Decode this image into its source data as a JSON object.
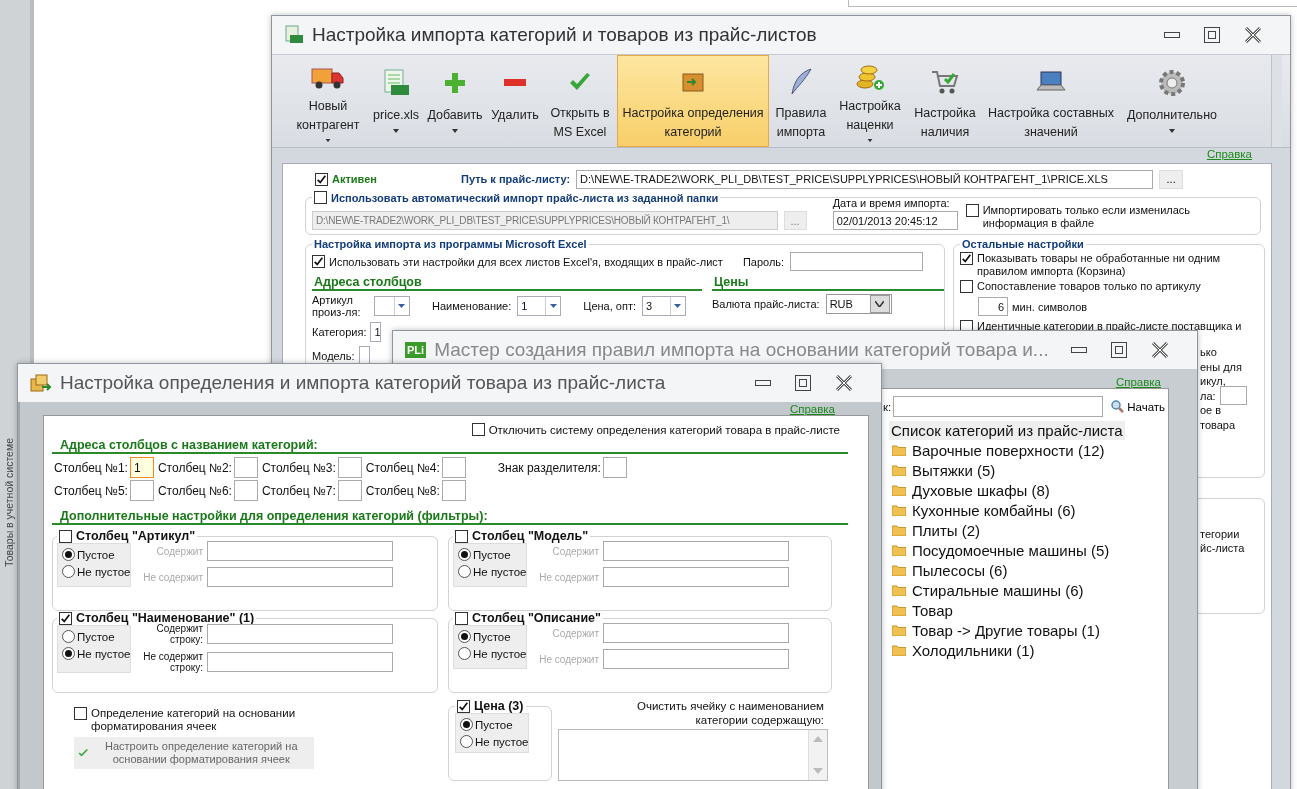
{
  "desktop": {
    "side_tab": "Товары в учетной системе"
  },
  "main_window": {
    "title": "Настройка импорта категорий и товаров из прайс-листов",
    "toolbar": [
      {
        "label": "Новый контрагент",
        "dropdown": true,
        "selected": false
      },
      {
        "label": "price.xls",
        "dropdown": true,
        "selected": false
      },
      {
        "label": "Добавить",
        "dropdown": true,
        "selected": false
      },
      {
        "label": "Удалить",
        "dropdown": false,
        "selected": false
      },
      {
        "label": "Открыть в MS Excel",
        "dropdown": false,
        "selected": false
      },
      {
        "label": "Настройка определения категорий",
        "dropdown": false,
        "selected": true
      },
      {
        "label": "Правила импорта",
        "dropdown": false,
        "selected": false
      },
      {
        "label": "Настройка наценки",
        "dropdown": true,
        "selected": false
      },
      {
        "label": "Настройка наличия",
        "dropdown": false,
        "selected": false
      },
      {
        "label": "Настройка составных значений",
        "dropdown": false,
        "selected": false
      },
      {
        "label": "Дополнительно",
        "dropdown": true,
        "selected": false
      }
    ],
    "help": "Справка",
    "active": {
      "label": "Активен",
      "checked": true
    },
    "path": {
      "label": "Путь к прайс-листу:",
      "value": "D:\\NEW\\E-TRADE2\\WORK_PLI_DB\\TEST_PRICE\\SUPPLYPRICES\\НОВЫЙ КОНТРАГЕНТ_1\\PRICE.XLS",
      "browse": "..."
    },
    "auto_import": {
      "label": "Использовать автоматический импорт прайс-листа из заданной папки",
      "checked": false,
      "folder": "D:\\NEW\\E-TRADE2\\WORK_PLI_DB\\TEST_PRICE\\SUPPLYPRICES\\НОВЫЙ КОНТРАГЕНТ_1\\",
      "browse": "...",
      "date_label": "Дата и время импорта:",
      "date": "02/01/2013 20:45:12",
      "only_changed": {
        "label": "Импортировать только если изменилась информация в файле",
        "checked": false
      }
    },
    "excel": {
      "title": "Настройка импорта из программы Microsoft Excel",
      "all_sheets": {
        "label": "Использовать эти настройки для всех листов Excel'я, входящих в прайс-лист",
        "checked": true
      },
      "password_label": "Пароль:",
      "columns_title": "Адреса столбцов",
      "prices_title": "Цены",
      "columns": [
        {
          "label": "Артикул произ-ля:"
        },
        {
          "label": "Наименование:",
          "value": "1"
        },
        {
          "label": "Цена, опт:",
          "value": "3"
        }
      ],
      "currency": {
        "label": "Валюта прайс-листа:",
        "value": "RUB"
      },
      "more_columns": [
        {
          "label": "Категория:",
          "value": "1"
        },
        {
          "label": "Модель:"
        }
      ]
    },
    "other": {
      "title": "Остальные настройки",
      "options": [
        {
          "label": "Показывать товары не обработанные ни одним правилом импорта (Корзина)",
          "checked": true
        },
        {
          "label": "Сопоставление товаров только по артикулу",
          "checked": false,
          "min_value": "6",
          "min_label": "мин. символов"
        },
        {
          "label": "Идентичные категории в прайс-листе поставщика и",
          "checked": false
        }
      ],
      "fragments": [
        {
          "text": "ько",
          "field": false
        },
        {
          "text": "ены для",
          "field": false
        },
        {
          "text": "икул,",
          "field": false
        },
        {
          "text": "ла:",
          "field": true
        },
        {
          "text": "ое в",
          "field": false
        },
        {
          "text": "товара",
          "field": false
        }
      ],
      "lower_fragments": [
        "тегории",
        "йс-листа"
      ]
    }
  },
  "wizard_window": {
    "title": "Мастер создания правил импорта на основании категорий товара и...",
    "logo": "PLi",
    "help": "Справка",
    "search_label": "к:",
    "search_button": "Начать",
    "list_header": "Список категорий из прайс-листа",
    "categories": [
      "Варочные поверхности (12)",
      "Вытяжки (5)",
      "Духовые шкафы (8)",
      "Кухонные комбайны (6)",
      "Плиты (2)",
      "Посудомоечные машины (5)",
      "Пылесосы (6)",
      "Стиральные машины (6)",
      "Товар",
      "Товар -> Другие товары (1)",
      "Холодильники (1)"
    ]
  },
  "left_window": {
    "title": "Настройка определения и импорта категорий товара из прайс-листа",
    "help": "Справка",
    "disable": {
      "label": "Отключить систему определения категорий товара в прайс-листе",
      "checked": false
    },
    "columns_title": "Адреса столбцов с названием категорий:",
    "columns": [
      {
        "label": "Столбец №1:",
        "value": "1",
        "focused": true
      },
      {
        "label": "Столбец №2:",
        "focused": false
      },
      {
        "label": "Столбец №3:",
        "focused": false
      },
      {
        "label": "Столбец №4:",
        "focused": false
      },
      {
        "label": "Столбец №5:",
        "focused": false
      },
      {
        "label": "Столбец №6:",
        "focused": false
      },
      {
        "label": "Столбец №7:",
        "focused": false
      },
      {
        "label": "Столбец №8:",
        "focused": false
      }
    ],
    "separator_label": "Знак разделителя:",
    "filters_title": "Дополнительные настройки для определения категорий (фильтры):",
    "filters": [
      {
        "title": "Столбец \"Артикул\"",
        "checked": false,
        "options": [
          {
            "label": "Пустое",
            "selected": true
          },
          {
            "label": "Не пустое",
            "selected": false
          }
        ],
        "contains": "Содержит",
        "not_contains": "Не содержит",
        "faded": true
      },
      {
        "title": "Столбец \"Модель\"",
        "checked": false,
        "options": [
          {
            "label": "Пустое",
            "selected": true
          },
          {
            "label": "Не пустое",
            "selected": false
          }
        ],
        "contains": "Содержит",
        "not_contains": "Не содержит",
        "faded": true
      },
      {
        "title": "Столбец \"Наименование\" (1)",
        "checked": true,
        "options": [
          {
            "label": "Пустое",
            "selected": false
          },
          {
            "label": "Не пустое",
            "selected": true
          }
        ],
        "contains": "Содержит строку:",
        "not_contains": "Не содержит строку:",
        "faded": false
      },
      {
        "title": "Столбец \"Описание\"",
        "checked": false,
        "options": [
          {
            "label": "Пустое",
            "selected": true
          },
          {
            "label": "Не пустое",
            "selected": false
          }
        ],
        "contains": "Содержит",
        "not_contains": "Не содержит",
        "faded": true
      }
    ],
    "formatting": {
      "label": "Определение категорий на основании форматирования ячеек",
      "checked": false,
      "button": "Настроить определение категорий на основании форматирования ячеек",
      "disabled": true
    },
    "price": {
      "title": "Цена (3)",
      "checked": true,
      "options": [
        {
          "label": "Пустое",
          "selected": true
        },
        {
          "label": "Не пустое",
          "selected": false
        }
      ]
    },
    "clear_label": "Очистить ячейку с наименованием категории содержащую:"
  }
}
